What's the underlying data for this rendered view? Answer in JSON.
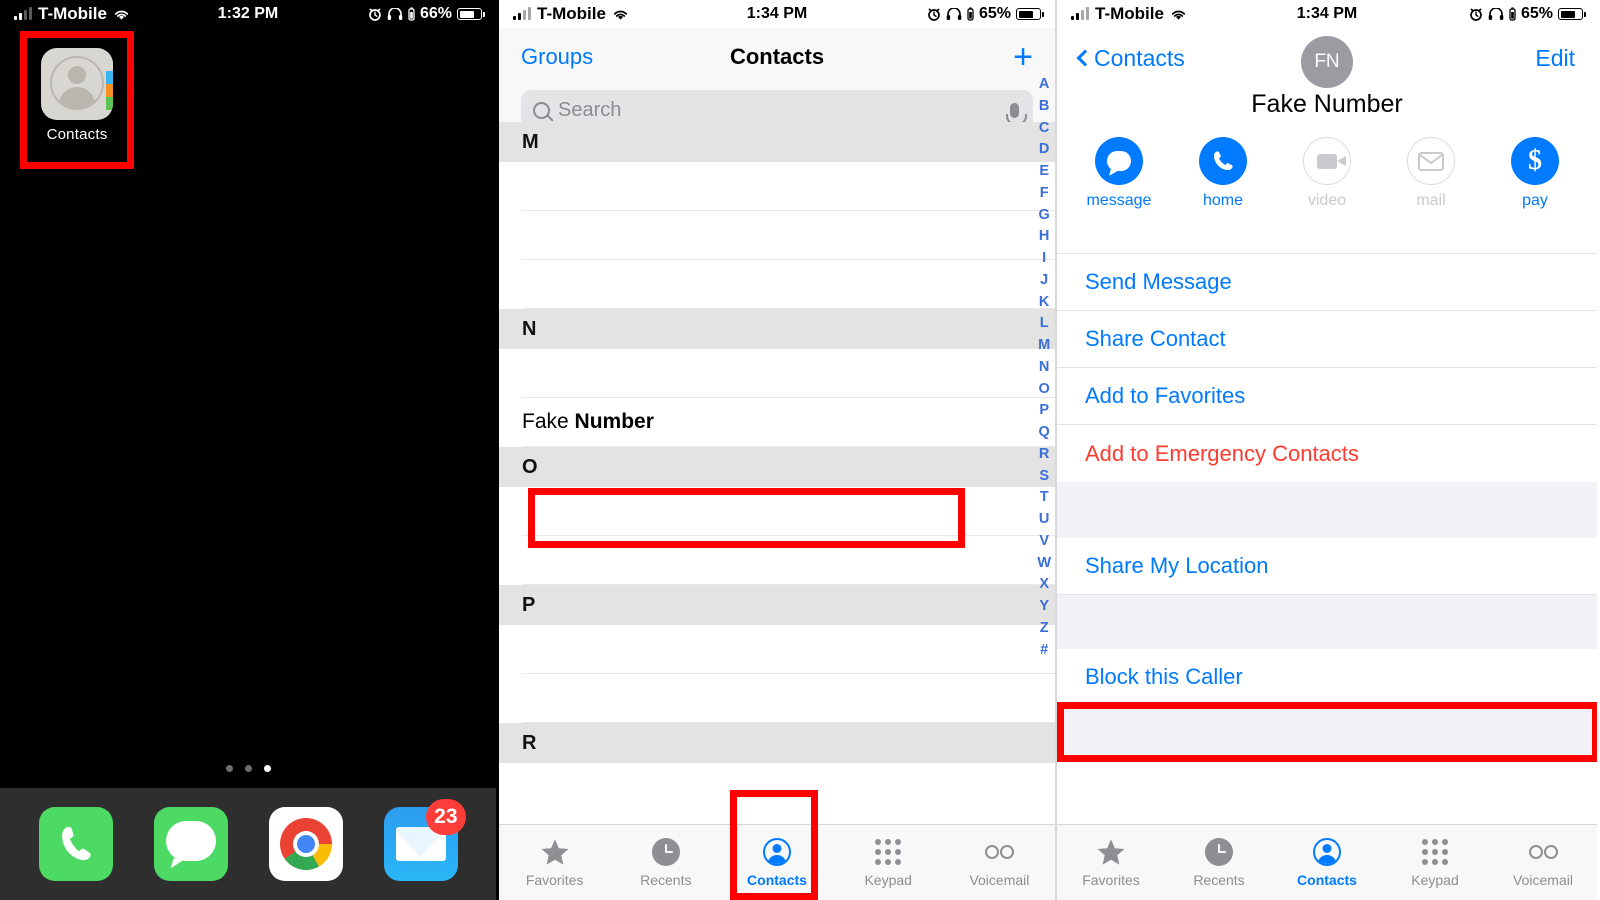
{
  "phone1": {
    "status": {
      "carrier": "T-Mobile",
      "time": "1:32 PM",
      "battery": "66%",
      "signal_icon": "signal-bars-icon",
      "wifi_icon": "wifi-icon",
      "alarm_icon": "alarm-icon",
      "headphones_icon": "headphones-icon"
    },
    "app": {
      "label": "Contacts",
      "icon": "contacts-app-icon"
    },
    "page_dots": 3,
    "active_dot": 3,
    "dock": [
      {
        "name": "phone",
        "icon": "phone-icon",
        "badge": ""
      },
      {
        "name": "messages",
        "icon": "messages-icon",
        "badge": ""
      },
      {
        "name": "chrome",
        "icon": "chrome-icon",
        "badge": ""
      },
      {
        "name": "mail",
        "icon": "mail-icon",
        "badge": "23"
      }
    ]
  },
  "phone2": {
    "status": {
      "carrier": "T-Mobile",
      "time": "1:34 PM",
      "battery": "65%"
    },
    "nav": {
      "left": "Groups",
      "title": "Contacts",
      "add": "+"
    },
    "search": {
      "placeholder": "Search",
      "value": "",
      "search_icon": "search-icon",
      "mic_icon": "microphone-icon"
    },
    "sections": [
      {
        "letter": "M",
        "rows": [
          "",
          "",
          ""
        ]
      },
      {
        "letter": "N",
        "rows": [
          "",
          {
            "first": "Fake",
            "last": "Number"
          }
        ]
      },
      {
        "letter": "O",
        "rows": [
          "",
          ""
        ]
      },
      {
        "letter": "P",
        "rows": [
          "",
          ""
        ]
      },
      {
        "letter": "R",
        "rows": []
      }
    ],
    "highlighted_row": "Fake Number",
    "alpha_index": [
      "A",
      "B",
      "C",
      "D",
      "E",
      "F",
      "G",
      "H",
      "I",
      "J",
      "K",
      "L",
      "M",
      "N",
      "O",
      "P",
      "Q",
      "R",
      "S",
      "T",
      "U",
      "V",
      "W",
      "X",
      "Y",
      "Z",
      "#"
    ],
    "tabs": [
      {
        "label": "Favorites",
        "icon": "star-icon",
        "active": false
      },
      {
        "label": "Recents",
        "icon": "clock-icon",
        "active": false
      },
      {
        "label": "Contacts",
        "icon": "person-circle-icon",
        "active": true
      },
      {
        "label": "Keypad",
        "icon": "keypad-icon",
        "active": false
      },
      {
        "label": "Voicemail",
        "icon": "voicemail-icon",
        "active": false
      }
    ],
    "highlighted_tab": "Contacts"
  },
  "phone3": {
    "status": {
      "carrier": "T-Mobile",
      "time": "1:34 PM",
      "battery": "65%"
    },
    "nav": {
      "back": "Contacts",
      "initials": "FN",
      "edit": "Edit"
    },
    "contact_name": "Fake Number",
    "quick_actions": [
      {
        "label": "message",
        "icon": "message-bubble-icon",
        "enabled": true
      },
      {
        "label": "home",
        "icon": "phone-handset-icon",
        "enabled": true
      },
      {
        "label": "video",
        "icon": "video-camera-icon",
        "enabled": false
      },
      {
        "label": "mail",
        "icon": "envelope-icon",
        "enabled": false
      },
      {
        "label": "pay",
        "icon": "dollar-sign-icon",
        "enabled": true
      }
    ],
    "list_items": [
      {
        "label": "Send Message",
        "style": "blue"
      },
      {
        "label": "Share Contact",
        "style": "blue"
      },
      {
        "label": "Add to Favorites",
        "style": "blue"
      },
      {
        "label": "Add to Emergency Contacts",
        "style": "red"
      }
    ],
    "list_items_2": [
      {
        "label": "Share My Location",
        "style": "blue"
      }
    ],
    "list_items_3": [
      {
        "label": "Block this Caller",
        "style": "blue"
      }
    ],
    "highlighted_item": "Block this Caller",
    "tabs": [
      {
        "label": "Favorites",
        "icon": "star-icon",
        "active": false
      },
      {
        "label": "Recents",
        "icon": "clock-icon",
        "active": false
      },
      {
        "label": "Contacts",
        "icon": "person-circle-icon",
        "active": true
      },
      {
        "label": "Keypad",
        "icon": "keypad-icon",
        "active": false
      },
      {
        "label": "Voicemail",
        "icon": "voicemail-icon",
        "active": false
      }
    ]
  },
  "colors": {
    "accent": "#007aff",
    "danger": "#ff3b30",
    "highlight": "#fe0000",
    "index": "#3a6fd8",
    "badge": "#fc3d39"
  }
}
